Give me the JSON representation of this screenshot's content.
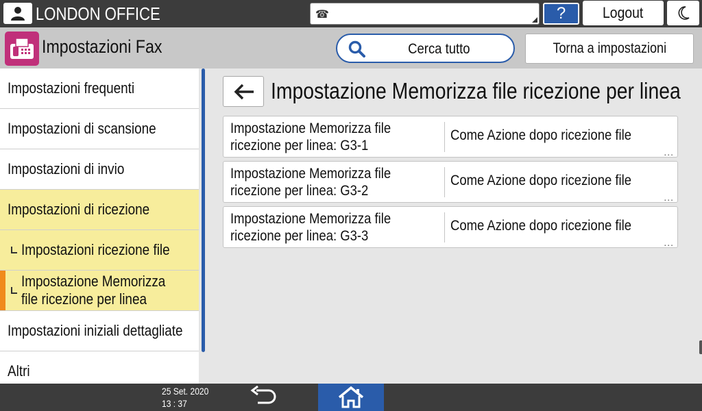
{
  "header": {
    "office_name": "LONDON OFFICE",
    "help_label": "?",
    "logout_label": "Logout"
  },
  "titlebar": {
    "app_title": "Impostazioni Fax",
    "search_all_label": "Cerca tutto",
    "back_to_settings_label": "Torna a impostazioni"
  },
  "sidebar": {
    "items": [
      {
        "label": "Impostazioni frequenti"
      },
      {
        "label": "Impostazioni di scansione"
      },
      {
        "label": "Impostazioni di invio"
      },
      {
        "label": "Impostazioni di ricezione"
      },
      {
        "label": "Impostazioni ricezione file"
      },
      {
        "label": "Impostazione Memorizza file ricezione per linea"
      },
      {
        "label": "Impostazioni iniziali dettagliate"
      },
      {
        "label": "Altri"
      }
    ]
  },
  "main": {
    "page_title": "Impostazione Memorizza file ricezione per linea",
    "rows": [
      {
        "name": "Impostazione Memorizza file ricezione per linea: G3-1",
        "value": "Come Azione dopo ricezione file"
      },
      {
        "name": "Impostazione Memorizza file ricezione per linea: G3-2",
        "value": "Come Azione dopo ricezione file"
      },
      {
        "name": "Impostazione Memorizza file ricezione per linea: G3-3",
        "value": "Come Azione dopo ricezione file"
      }
    ],
    "more_indicator": "..."
  },
  "footer": {
    "date": "25 Set. 2020",
    "time": "13 : 37"
  },
  "colors": {
    "accent_blue": "#2a5caa",
    "selected_yellow": "#f7ed9c",
    "active_orange": "#f08a1c",
    "fax_app_pink": "#c0307a",
    "dark_bar": "#3c3c3c"
  },
  "icons": [
    "user-icon",
    "fax-line-icon",
    "moon-icon",
    "fax-app-icon",
    "search-icon",
    "back-arrow-icon",
    "return-icon",
    "home-icon"
  ]
}
